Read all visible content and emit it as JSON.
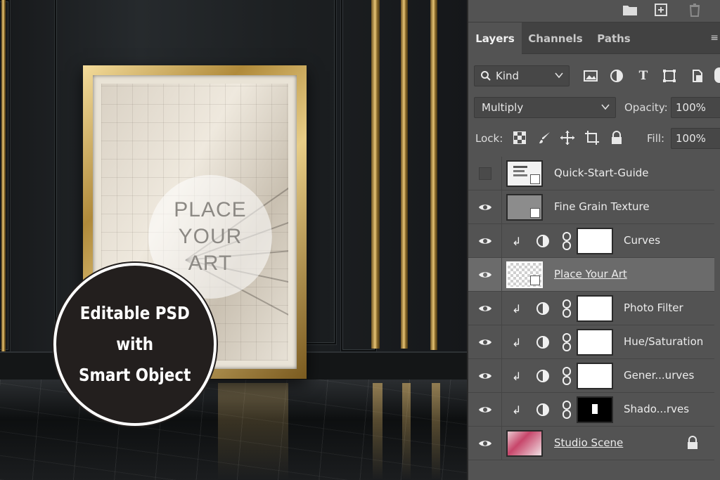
{
  "mockup": {
    "placeholder_lines": [
      "PLACE",
      "YOUR",
      "ART"
    ],
    "badge_lines": [
      "Editable PSD",
      "with",
      "Smart Object"
    ]
  },
  "panel": {
    "top_icons": [
      "folder-icon",
      "new-layer-icon",
      "trash-icon"
    ],
    "tabs": [
      {
        "label": "Layers",
        "active": true
      },
      {
        "label": "Channels",
        "active": false
      },
      {
        "label": "Paths",
        "active": false
      }
    ],
    "filter": {
      "kind_label": "Kind",
      "icons": [
        "image-filter-icon",
        "adjustment-filter-icon",
        "type-filter-icon",
        "shape-filter-icon",
        "smart-object-filter-icon"
      ]
    },
    "blend_mode": "Multiply",
    "opacity_label": "Opacity:",
    "opacity_value": "100%",
    "lock_label": "Lock:",
    "lock_icons": [
      "lock-transparent-icon",
      "lock-image-icon",
      "lock-position-icon",
      "lock-artboard-icon",
      "lock-all-icon"
    ],
    "fill_label": "Fill:",
    "fill_value": "100%",
    "layers": [
      {
        "name": "Quick-Start-Guide",
        "visible": false,
        "kind": "smart-object",
        "selected": false
      },
      {
        "name": "Fine Grain Texture",
        "visible": true,
        "kind": "smart-object",
        "selected": false
      },
      {
        "name": "Curves",
        "visible": true,
        "kind": "adjustment",
        "selected": false
      },
      {
        "name": "Place Your Art",
        "visible": true,
        "kind": "smart-object",
        "selected": true
      },
      {
        "name": "Photo Filter",
        "visible": true,
        "kind": "adjustment",
        "selected": false
      },
      {
        "name": "Hue/Saturation",
        "visible": true,
        "kind": "adjustment",
        "selected": false
      },
      {
        "name": "Gener...urves",
        "visible": true,
        "kind": "adjustment",
        "selected": false
      },
      {
        "name": "Shado...rves",
        "visible": true,
        "kind": "adjustment",
        "selected": false
      },
      {
        "name": "Studio Scene",
        "visible": true,
        "kind": "image",
        "selected": false,
        "locked": true
      }
    ]
  },
  "colors": {
    "panel_bg": "#535353",
    "selected_row": "#6b6b6b",
    "gold": "#c9a45a",
    "badge_bg": "#231f1e"
  }
}
